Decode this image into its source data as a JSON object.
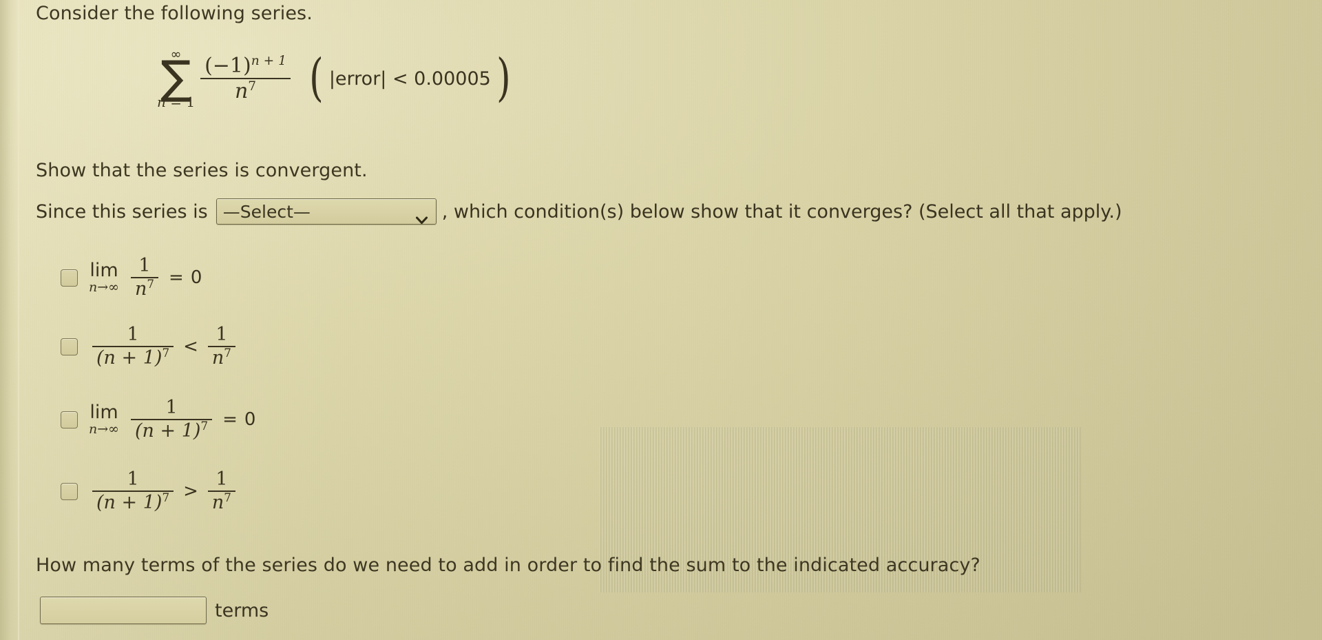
{
  "background_color": "#d6cfa1",
  "text_color": "#3a3320",
  "prompt": {
    "consider": "Consider the following series.",
    "show_convergent": "Show that the series is convergent.",
    "since_prefix": "Since this series is",
    "since_suffix": ", which condition(s) below show that it converges? (Select all that apply.)",
    "how_many": "How many terms of the series do we need to add in order to find the sum to the indicated accuracy?"
  },
  "formula": {
    "sigma_upper": "∞",
    "sigma_symbol": "∑",
    "sigma_lower_var": "n",
    "sigma_lower_eq": " = 1",
    "numerator_base": "(−1)",
    "numerator_exponent": "n + 1",
    "denominator_base": "n",
    "denominator_exponent": "7",
    "error_note": "|error|  <  0.00005",
    "paren_open": "(",
    "paren_close": ")"
  },
  "select": {
    "value": "—Select—",
    "chevron": "chevron-down-icon",
    "options": [
      "—Select—"
    ]
  },
  "options": [
    {
      "id": "opt-0",
      "checked": false,
      "type": "limit",
      "lim_label": "lim",
      "lim_sub_var": "n",
      "lim_sub_arrow": "→",
      "lim_sub_inf": "∞",
      "frac_num": "1",
      "frac_den_base": "n",
      "frac_den_exp": "7",
      "relation": "=",
      "rhs": "0",
      "plain": "lim n→∞ 1/n^7 = 0"
    },
    {
      "id": "opt-1",
      "checked": false,
      "type": "inequality",
      "left_num": "1",
      "left_den_base": "(n + 1)",
      "left_den_exp": "7",
      "relation": "<",
      "right_num": "1",
      "right_den_base": "n",
      "right_den_exp": "7",
      "plain": "1/(n+1)^7 < 1/n^7"
    },
    {
      "id": "opt-2",
      "checked": false,
      "type": "limit",
      "lim_label": "lim",
      "lim_sub_var": "n",
      "lim_sub_arrow": "→",
      "lim_sub_inf": "∞",
      "frac_num": "1",
      "frac_den_base": "(n + 1)",
      "frac_den_exp": "7",
      "relation": "=",
      "rhs": "0",
      "plain": "lim n→∞ 1/(n+1)^7 = 0"
    },
    {
      "id": "opt-3",
      "checked": false,
      "type": "inequality",
      "left_num": "1",
      "left_den_base": "(n + 1)",
      "left_den_exp": "7",
      "relation": ">",
      "right_num": "1",
      "right_den_base": "n",
      "right_den_exp": "7",
      "plain": "1/(n+1)^7 > 1/n^7"
    }
  ],
  "answer": {
    "value": "",
    "placeholder": "",
    "unit_label": "terms"
  }
}
